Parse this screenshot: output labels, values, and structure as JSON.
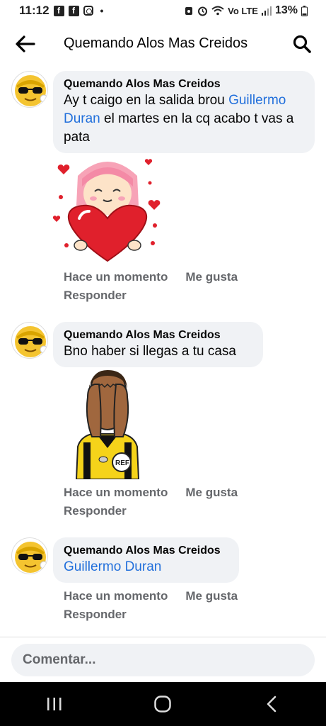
{
  "status_bar": {
    "time": "11:12",
    "fb_glyph": "f",
    "dot": "•",
    "network": "Vo LTE",
    "battery": "13%",
    "icons": [
      "facebook-icon",
      "facebook-icon",
      "instagram-icon",
      "dot",
      "alarm-icon",
      "wifi-icon",
      "signal-icon",
      "battery-icon"
    ]
  },
  "header": {
    "title": "Quemando Alos Mas Creidos"
  },
  "comments": [
    {
      "author": "Quemando Alos Mas Creidos",
      "text_before": "Ay t caigo en la salida brou ",
      "mention": "Guillermo Duran",
      "text_after": " el martes en la cq acabo t vas a pata",
      "sticker": "girl-heart-sticker",
      "time": "Hace un momento",
      "like": "Me gusta",
      "reply": "Responder"
    },
    {
      "author": "Quemando Alos Mas Creidos",
      "text": "Bno haber si llegas a tu casa",
      "sticker": "referee-facepalm-sticker",
      "sticker_text": "REF",
      "time": "Hace un momento",
      "like": "Me gusta",
      "reply": "Responder"
    },
    {
      "author": "Quemando Alos Mas Creidos",
      "mention": "Guillermo Duran",
      "time": "Hace un momento",
      "like": "Me gusta",
      "reply": "Responder"
    }
  ],
  "composer": {
    "placeholder": "Comentar..."
  },
  "nav": [
    "recent-apps-icon",
    "home-icon",
    "back-icon"
  ],
  "colors": {
    "mention": "#216fdb",
    "bubble": "#f0f2f5",
    "secondary_text": "#65676b"
  }
}
